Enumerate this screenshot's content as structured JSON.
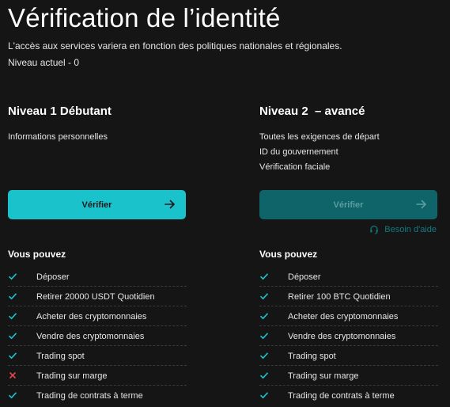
{
  "page": {
    "title": "Vérification de l’identité",
    "subtitle": "L'accès aux services variera en fonction des politiques nationales et régionales.",
    "current_level": "Niveau actuel - 0"
  },
  "colors": {
    "accent": "#1ac2cc",
    "accent_disabled": "#0e6468",
    "check": "#1ac2cc",
    "cross": "#e0464b",
    "background": "#151515"
  },
  "levels": [
    {
      "title": "Niveau 1 Débutant",
      "requirements": [
        "Informations personnelles"
      ],
      "button_label": "Vérifier",
      "button_state": "active",
      "can_title": "Vous pouvez",
      "features": [
        {
          "label": "Déposer",
          "allowed": true,
          "icon": "check-icon"
        },
        {
          "label": "Retirer 20000 USDT Quotidien",
          "allowed": true,
          "icon": "check-icon"
        },
        {
          "label": "Acheter des cryptomonnaies",
          "allowed": true,
          "icon": "check-icon"
        },
        {
          "label": "Vendre des cryptomonnaies",
          "allowed": true,
          "icon": "check-icon"
        },
        {
          "label": "Trading spot",
          "allowed": true,
          "icon": "check-icon"
        },
        {
          "label": "Trading sur marge",
          "allowed": false,
          "icon": "cross-icon"
        },
        {
          "label": "Trading de contrats à terme",
          "allowed": true,
          "icon": "check-icon"
        }
      ]
    },
    {
      "title": "Niveau 2  – avancé",
      "requirements": [
        "Toutes les exigences de départ",
        "ID du gouvernement",
        "Vérification faciale"
      ],
      "button_label": "Vérifier",
      "button_state": "disabled",
      "help_label": "Besoin d'aide",
      "can_title": "Vous pouvez",
      "features": [
        {
          "label": "Déposer",
          "allowed": true,
          "icon": "check-icon"
        },
        {
          "label": "Retirer 100 BTC Quotidien",
          "allowed": true,
          "icon": "check-icon"
        },
        {
          "label": "Acheter des cryptomonnaies",
          "allowed": true,
          "icon": "check-icon"
        },
        {
          "label": "Vendre des cryptomonnaies",
          "allowed": true,
          "icon": "check-icon"
        },
        {
          "label": "Trading spot",
          "allowed": true,
          "icon": "check-icon"
        },
        {
          "label": "Trading sur marge",
          "allowed": true,
          "icon": "check-icon"
        },
        {
          "label": "Trading de contrats à terme",
          "allowed": true,
          "icon": "check-icon"
        }
      ]
    }
  ]
}
